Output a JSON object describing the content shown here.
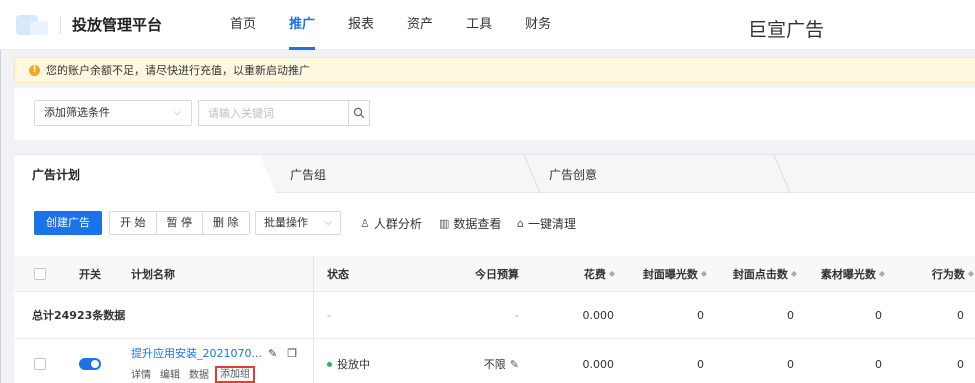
{
  "header": {
    "app_title": "投放管理平台",
    "nav": [
      "首页",
      "推广",
      "报表",
      "资产",
      "工具",
      "财务"
    ],
    "active_nav": "推广",
    "brand": "巨宣广告"
  },
  "warning": {
    "text": "您的账户余额不足，请尽快进行充值，以重新启动推广"
  },
  "filters": {
    "condition_select": "添加筛选条件",
    "keyword_placeholder": "请输入关键词"
  },
  "tabs": [
    "广告计划",
    "广告组",
    "广告创意"
  ],
  "toolbar": {
    "create": "创建广告",
    "group_buttons": [
      "开 始",
      "暂 停",
      "删 除"
    ],
    "batch": "批量操作",
    "links": [
      "人群分析",
      "数据查看",
      "一键清理"
    ]
  },
  "table": {
    "headers": {
      "switch": "开关",
      "name": "计划名称",
      "status": "状态",
      "budget": "今日预算",
      "cost": "花费",
      "cover_impr": "封面曝光数",
      "cover_click": "封面点击数",
      "material_impr": "素材曝光数",
      "actions": "行为数"
    },
    "summary": {
      "label": "总计24923条数据",
      "status": "-",
      "budget": "-",
      "cost": "0.000",
      "cover_impr": "0",
      "cover_click": "0",
      "material_impr": "0",
      "actions": "0"
    },
    "row": {
      "name": "提升应用安装_2021070...",
      "ops": [
        "详情",
        "编辑",
        "数据",
        "添加组"
      ],
      "status": "投放中",
      "budget": "不限",
      "cost": "0.000",
      "cover_impr": "0",
      "cover_click": "0",
      "material_impr": "0",
      "actions": "0"
    }
  }
}
